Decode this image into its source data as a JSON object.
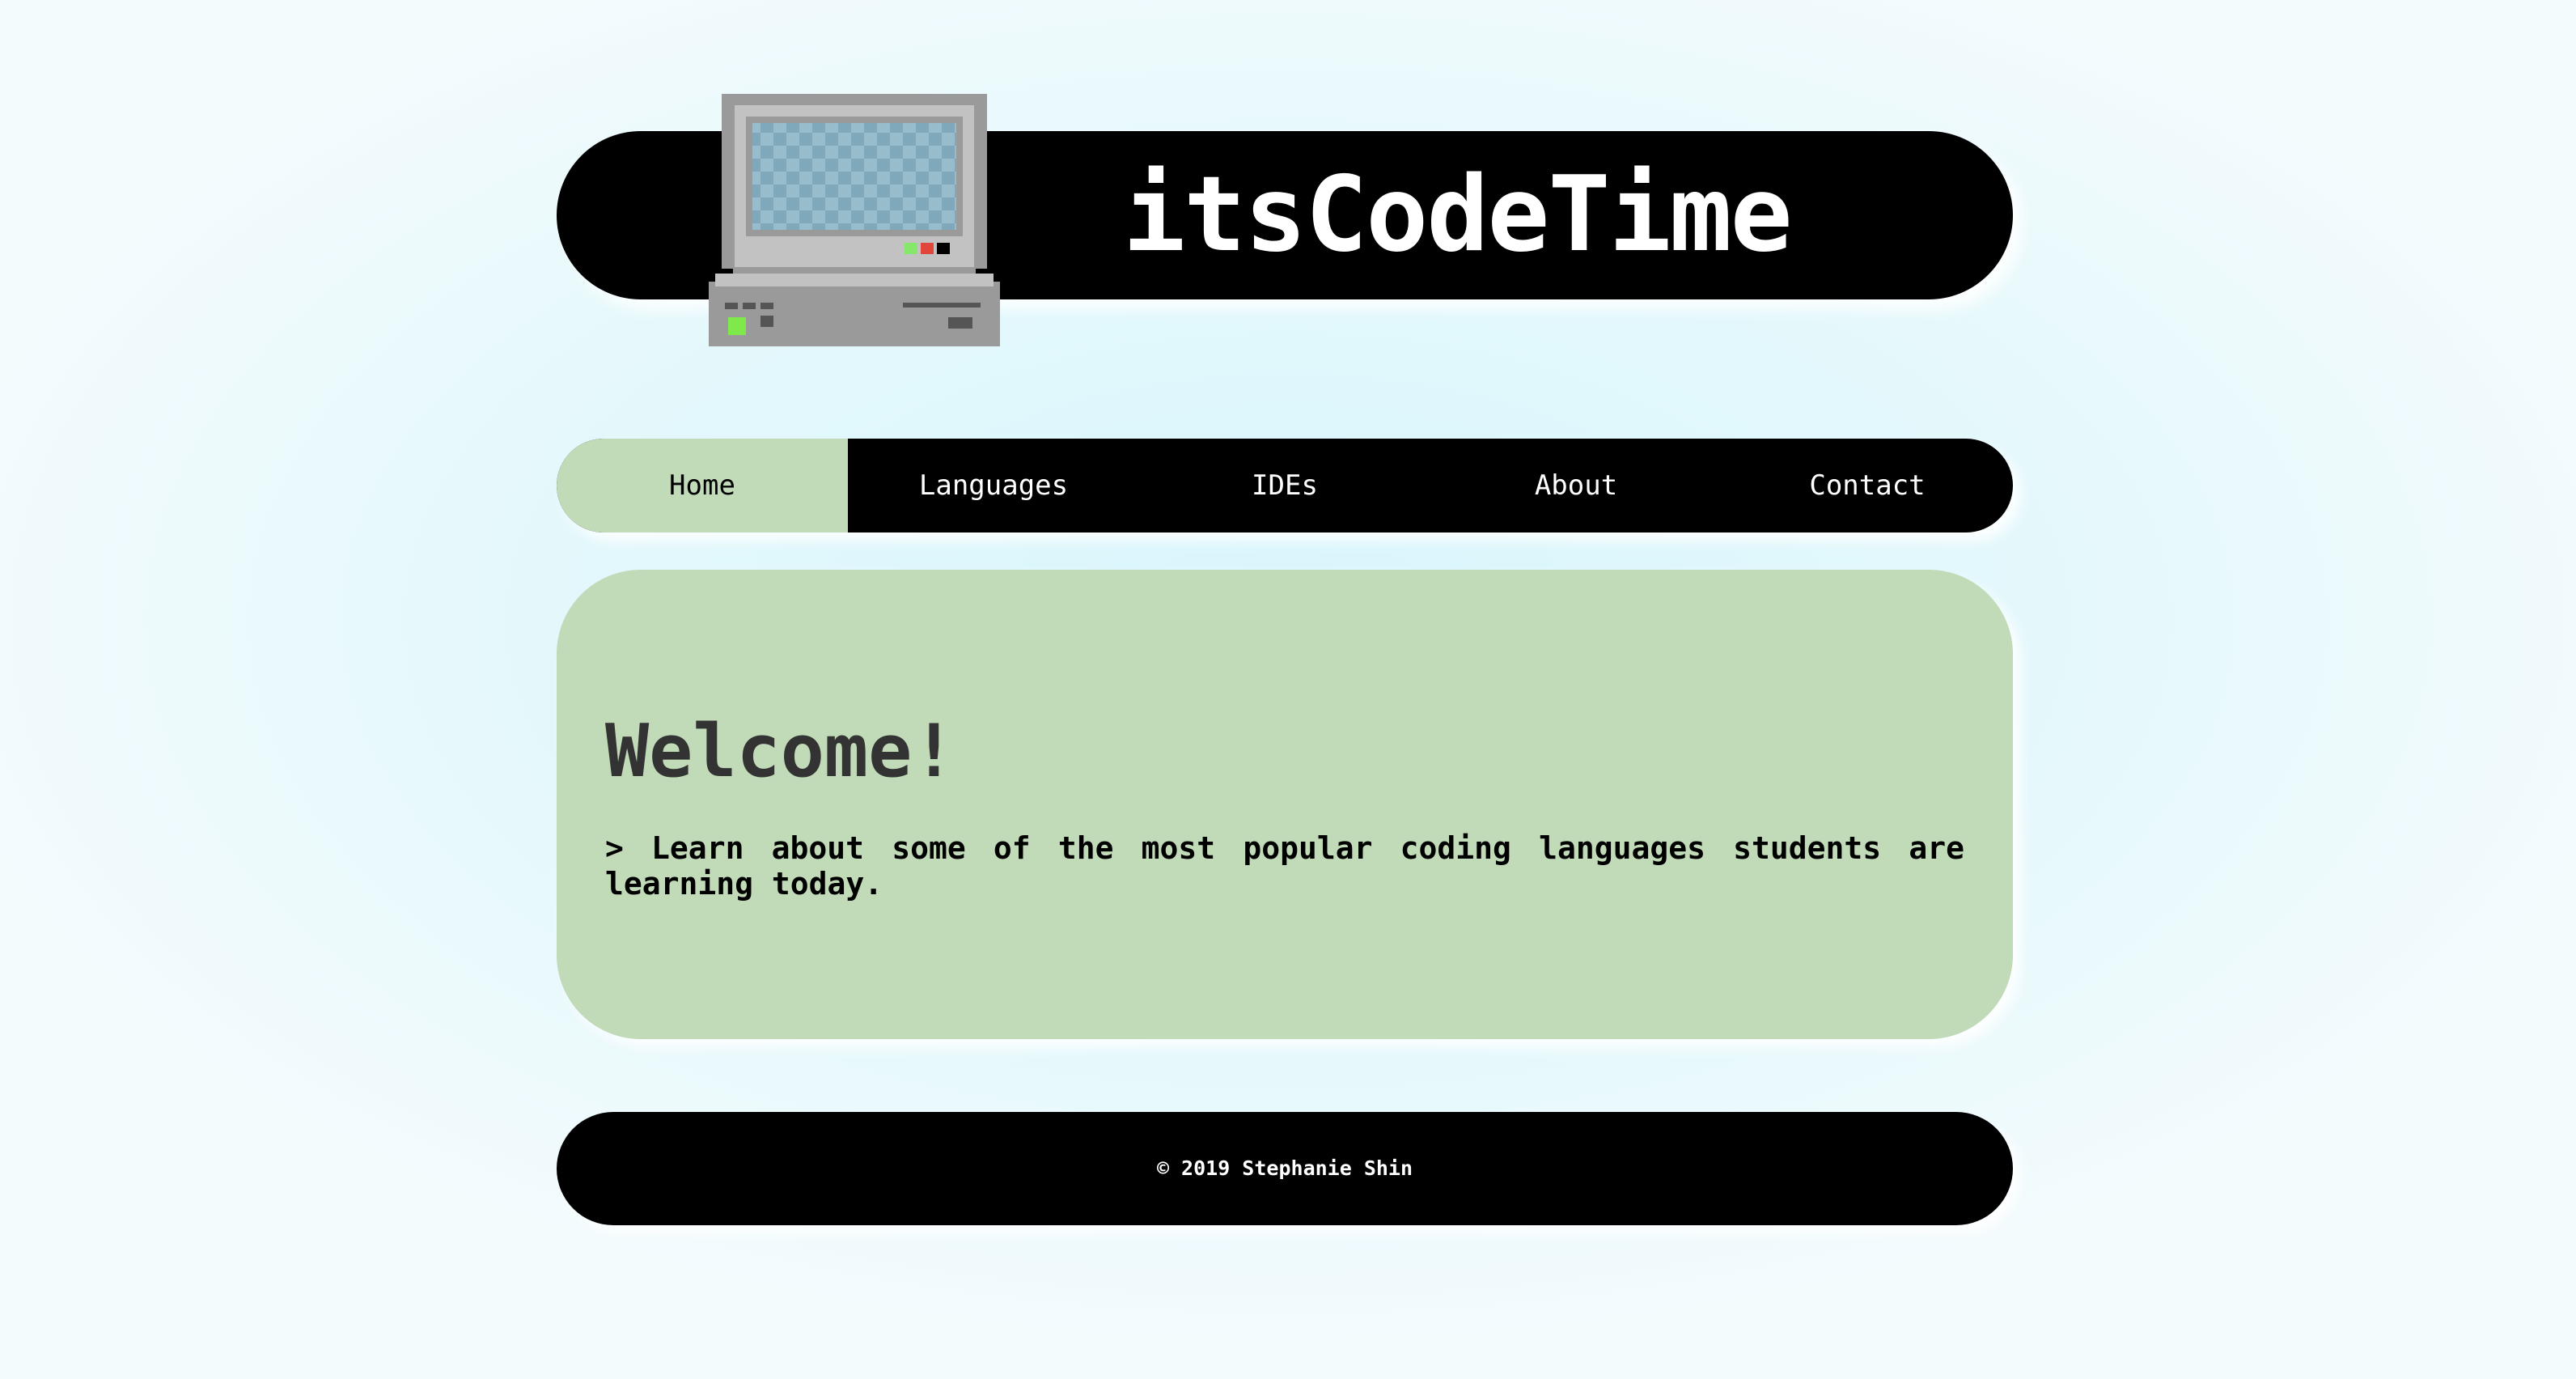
{
  "header": {
    "title": "itsCodeTime",
    "logo_icon": "retro-computer-icon"
  },
  "nav": {
    "items": [
      {
        "label": "Home",
        "active": true
      },
      {
        "label": "Languages",
        "active": false
      },
      {
        "label": "IDEs",
        "active": false
      },
      {
        "label": "About",
        "active": false
      },
      {
        "label": "Contact",
        "active": false
      }
    ]
  },
  "main": {
    "heading": "Welcome!",
    "intro": "> Learn about some of the most popular coding languages students are learning today."
  },
  "footer": {
    "copyright": "© 2019 Stephanie Shin"
  },
  "colors": {
    "accent_green": "#c1dab8",
    "bar_black": "#000000",
    "background": "#e0f8fc"
  }
}
